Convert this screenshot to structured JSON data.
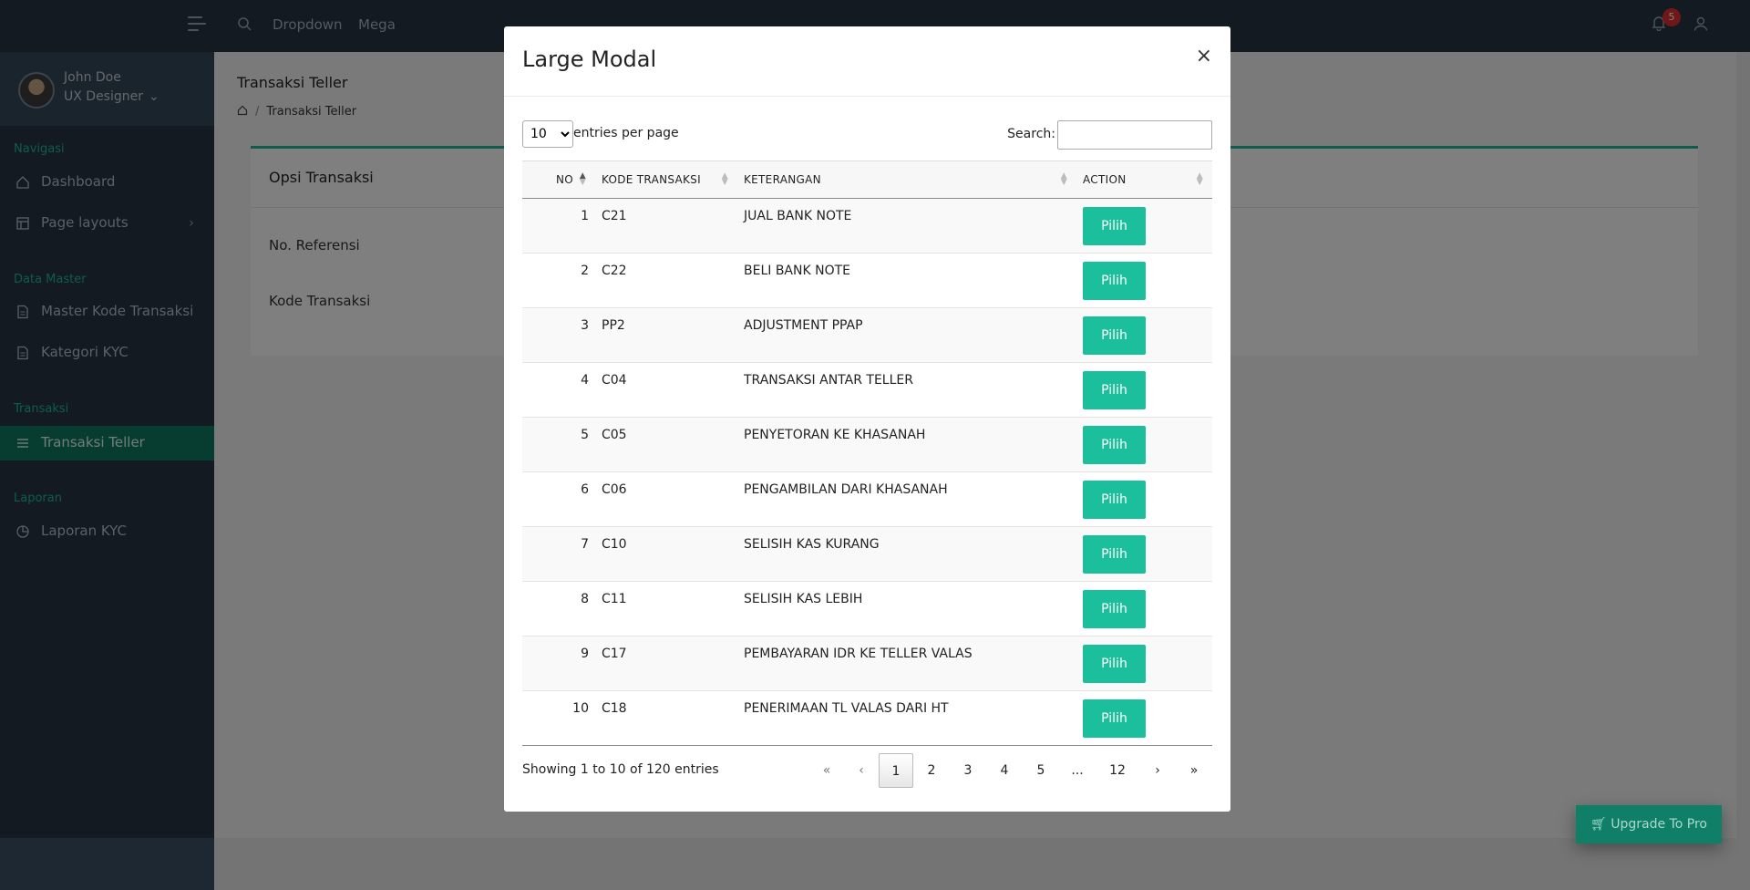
{
  "topbar": {
    "nav": [
      "Dropdown",
      "Mega"
    ],
    "notification_count": "5"
  },
  "sidebar": {
    "user_name": "John Doe",
    "user_role": "UX Designer",
    "sections": {
      "navigasi": "Navigasi",
      "data_master": "Data Master",
      "transaksi": "Transaksi",
      "laporan": "Laporan"
    },
    "items": {
      "dashboard": "Dashboard",
      "page_layouts": "Page layouts",
      "master_kode": "Master Kode Transaksi",
      "kategori_kyc": "Kategori KYC",
      "transaksi_teller": "Transaksi Teller",
      "laporan_kyc": "Laporan KYC"
    }
  },
  "main": {
    "title": "Transaksi Teller",
    "breadcrumb": "Transaksi Teller",
    "card_title": "Opsi Transaksi",
    "field_ref": "No. Referensi",
    "field_kode": "Kode Transaksi"
  },
  "upgrade_label": "Upgrade To Pro",
  "modal": {
    "title": "Large Modal",
    "close": "×",
    "length_value": "10",
    "length_label": "entries per page",
    "search_label": "Search:",
    "columns": [
      "NO",
      "KODE TRANSAKSI",
      "KETERANGAN",
      "ACTION"
    ],
    "rows": [
      {
        "no": "1",
        "kode": "C21",
        "ket": "JUAL BANK NOTE",
        "action": "Pilih"
      },
      {
        "no": "2",
        "kode": "C22",
        "ket": "BELI BANK NOTE",
        "action": "Pilih"
      },
      {
        "no": "3",
        "kode": "PP2",
        "ket": "ADJUSTMENT PPAP",
        "action": "Pilih"
      },
      {
        "no": "4",
        "kode": "C04",
        "ket": "TRANSAKSI ANTAR TELLER",
        "action": "Pilih"
      },
      {
        "no": "5",
        "kode": "C05",
        "ket": "PENYETORAN KE KHASANAH",
        "action": "Pilih"
      },
      {
        "no": "6",
        "kode": "C06",
        "ket": "PENGAMBILAN DARI KHASANAH",
        "action": "Pilih"
      },
      {
        "no": "7",
        "kode": "C10",
        "ket": "SELISIH KAS KURANG",
        "action": "Pilih"
      },
      {
        "no": "8",
        "kode": "C11",
        "ket": "SELISIH KAS LEBIH",
        "action": "Pilih"
      },
      {
        "no": "9",
        "kode": "C17",
        "ket": "PEMBAYARAN IDR KE TELLER VALAS",
        "action": "Pilih"
      },
      {
        "no": "10",
        "kode": "C18",
        "ket": "PENERIMAAN TL VALAS DARI HT",
        "action": "Pilih"
      }
    ],
    "info": "Showing 1 to 10 of 120 entries",
    "pagination": [
      "«",
      "‹",
      "1",
      "2",
      "3",
      "4",
      "5",
      "...",
      "12",
      "›",
      "»"
    ],
    "current_page": "1"
  },
  "colors": {
    "accent": "#1cbf9b",
    "sidebar_bg": "#263544",
    "active_item": "#0e7a62"
  }
}
